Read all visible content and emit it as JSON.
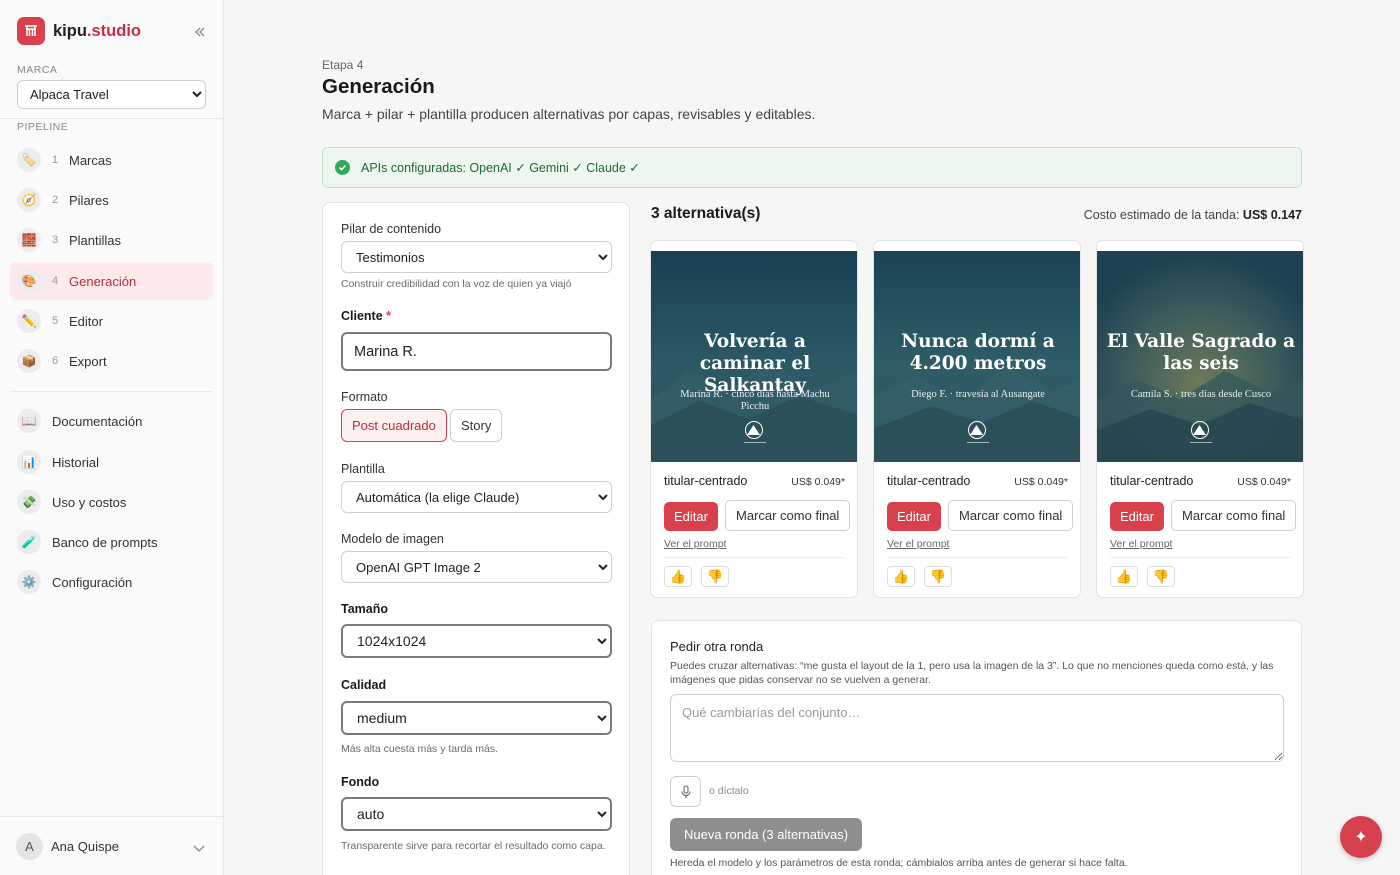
{
  "brand": {
    "name_main": "kipu",
    "name_accent": ".studio"
  },
  "sidebar": {
    "marca_label": "MARCA",
    "marca_value": "Alpaca Travel",
    "pipeline_label": "PIPELINE",
    "pipeline": [
      {
        "num": "1",
        "label": "Marcas",
        "icon": "tag-icon",
        "glyph": "🏷️"
      },
      {
        "num": "2",
        "label": "Pilares",
        "icon": "compass-icon",
        "glyph": "🧭"
      },
      {
        "num": "3",
        "label": "Plantillas",
        "icon": "bricks-icon",
        "glyph": "🧱"
      },
      {
        "num": "4",
        "label": "Generación",
        "icon": "palette-icon",
        "glyph": "🎨"
      },
      {
        "num": "5",
        "label": "Editor",
        "icon": "pencil-icon",
        "glyph": "✏️"
      },
      {
        "num": "6",
        "label": "Export",
        "icon": "package-icon",
        "glyph": "📦"
      }
    ],
    "links": [
      {
        "label": "Documentación",
        "icon": "book-icon",
        "glyph": "📖"
      },
      {
        "label": "Historial",
        "icon": "chart-icon",
        "glyph": "📊"
      },
      {
        "label": "Uso y costos",
        "icon": "money-icon",
        "glyph": "💸"
      },
      {
        "label": "Banco de prompts",
        "icon": "test-tube-icon",
        "glyph": "🧪"
      },
      {
        "label": "Configuración",
        "icon": "gear-icon",
        "glyph": "⚙️"
      }
    ],
    "user": {
      "initial": "A",
      "name": "Ana Quispe"
    }
  },
  "header": {
    "eyebrow": "Etapa 4",
    "title": "Generación",
    "subtitle": "Marca + pilar + plantilla producen alternativas por capas, revisables y editables."
  },
  "banner": {
    "text": "APIs configuradas: OpenAI ✓ Gemini ✓ Claude ✓"
  },
  "form": {
    "pilar_label": "Pilar de contenido",
    "pilar_value": "Testimonios",
    "pilar_hint": "Construir credibilidad con la voz de quien ya viajó",
    "cliente_label": "Cliente",
    "cliente_req": "*",
    "cliente_value": "Marina R.",
    "formato_label": "Formato",
    "formato_options": [
      "Post cuadrado",
      "Story"
    ],
    "plantilla_label": "Plantilla",
    "plantilla_value": "Automática (la elige Claude)",
    "modelo_label": "Modelo de imagen",
    "modelo_value": "OpenAI GPT Image 2",
    "tamano_label": "Tamaño",
    "tamano_value": "1024x1024",
    "calidad_label": "Calidad",
    "calidad_value": "medium",
    "calidad_hint": "Más alta cuesta más y tarda más.",
    "fondo_label": "Fondo",
    "fondo_value": "auto",
    "fondo_hint": "Transparente sirve para recortar el resultado como capa."
  },
  "results": {
    "title": "3 alternativa(s)",
    "cost_label": "Costo estimado de la tanda:",
    "cost_value": "US$ 0.147",
    "cards": [
      {
        "headline": "Volvería a caminar el Salkantay",
        "caption": "Marina R. · cinco días hasta Machu Picchu",
        "template": "titular-centrado",
        "price": "US$ 0.049*",
        "edit": "Editar",
        "final": "Marcar como final",
        "prompt_link": "Ver el prompt"
      },
      {
        "headline": "Nunca dormí a 4.200 metros",
        "caption": "Diego F. · travesía al Ausangate",
        "template": "titular-centrado",
        "price": "US$ 0.049*",
        "edit": "Editar",
        "final": "Marcar como final",
        "prompt_link": "Ver el prompt"
      },
      {
        "headline": "El Valle Sagrado a las seis",
        "caption": "Camila S. · tres días desde Cusco",
        "template": "titular-centrado",
        "price": "US$ 0.049*",
        "edit": "Editar",
        "final": "Marcar como final",
        "prompt_link": "Ver el prompt"
      }
    ]
  },
  "round": {
    "title": "Pedir otra ronda",
    "description": "Puedes cruzar alternativas: “me gusta el layout de la 1, pero usa la imagen de la 3”. Lo que no menciones queda como está, y las imágenes que pidas conservar no se vuelven a generar.",
    "placeholder": "Qué cambiarías del conjunto…",
    "dictate": "o díctalo",
    "button": "Nueva ronda (3 alternativas)",
    "footnote": "Hereda el modelo y los parámetros de esta ronda; cámbialos arriba antes de generar si hace falta."
  },
  "colors": {
    "accent": "#d8404d",
    "success": "#2fa857",
    "card_sky_top": "#1b4456",
    "card_sky_glow_3": "#6b7a58"
  }
}
